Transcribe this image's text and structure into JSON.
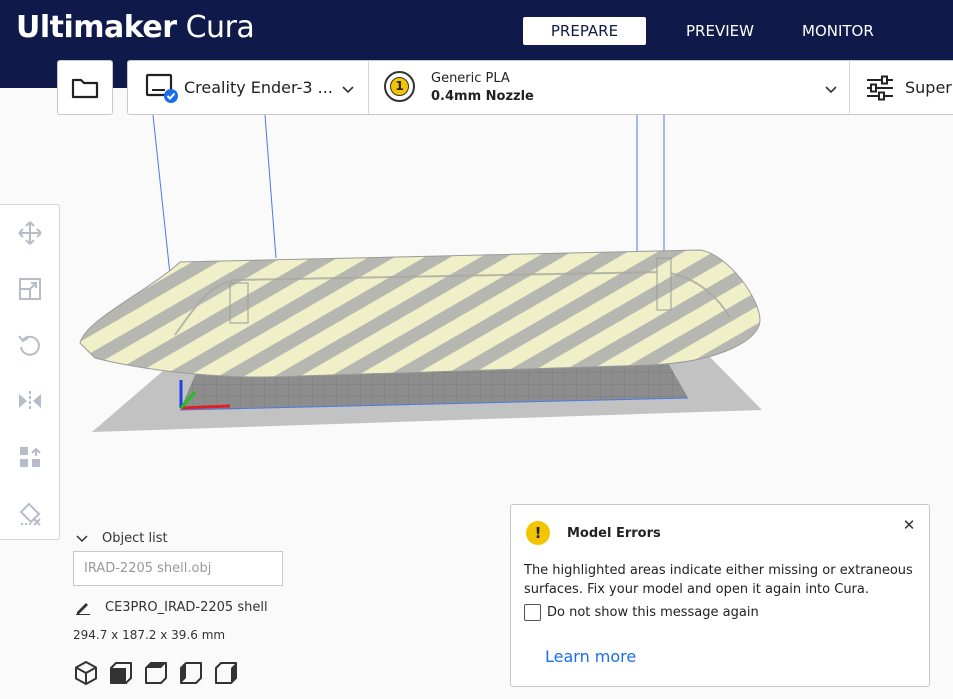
{
  "app": {
    "brand": "Ultimaker",
    "product": "Cura"
  },
  "header": {
    "tabs": [
      "PREPARE",
      "PREVIEW",
      "MONITOR"
    ],
    "active_tab": "PREPARE"
  },
  "toolbar": {
    "printer_name": "Creality Ender-3 ...",
    "extruder_number": "1",
    "material_name": "Generic PLA",
    "nozzle": "0.4mm Nozzle",
    "settings_label": "Super"
  },
  "object_list": {
    "label": "Object list",
    "file_name": "IRAD-2205 shell.obj",
    "object_name": "CE3PRO_IRAD-2205 shell",
    "dimensions": "294.7 x 187.2 x 39.6 mm"
  },
  "dialog": {
    "title": "Model Errors",
    "message": "The highlighted areas indicate either missing or extraneous surfaces. Fix your model and open it again into Cura.",
    "checkbox_label": "Do not show this message again",
    "checkbox_checked": false,
    "link": "Learn more"
  },
  "icons": {
    "tools": [
      "move-icon",
      "scale-icon",
      "rotate-icon",
      "mirror-icon",
      "per-model-settings-icon",
      "support-blocker-icon"
    ],
    "views": [
      "3d-view-icon",
      "front-view-icon",
      "top-view-icon",
      "left-view-icon",
      "right-view-icon"
    ]
  },
  "colors": {
    "header_bg": "#0f1a4a",
    "accent_link": "#196ef0",
    "warning": "#f2c500",
    "model_light": "#efefc8",
    "model_dark": "#b4b4b4"
  }
}
